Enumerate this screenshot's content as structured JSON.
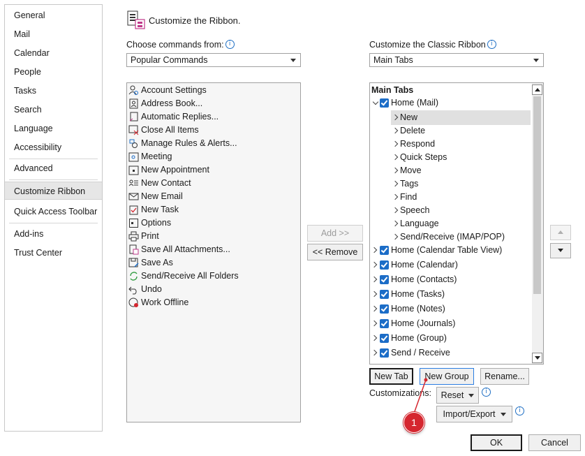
{
  "nav": {
    "items": [
      "General",
      "Mail",
      "Calendar",
      "People",
      "Tasks",
      "Search",
      "Language",
      "Accessibility",
      "Advanced",
      "Customize Ribbon",
      "Quick Access Toolbar",
      "Add-ins",
      "Trust Center"
    ],
    "selected": "Customize Ribbon"
  },
  "header": {
    "title": "Customize the Ribbon."
  },
  "left_panel": {
    "label": "Choose commands from:",
    "combo_value": "Popular Commands",
    "commands": [
      {
        "label": "Account Settings",
        "icon": "person-gear-icon"
      },
      {
        "label": "Address Book...",
        "icon": "address-book-icon"
      },
      {
        "label": "Automatic Replies...",
        "icon": "auto-reply-icon"
      },
      {
        "label": "Close All Items",
        "icon": "close-items-icon"
      },
      {
        "label": "Manage Rules & Alerts...",
        "icon": "rules-icon"
      },
      {
        "label": "Meeting",
        "icon": "meeting-icon"
      },
      {
        "label": "New Appointment",
        "icon": "appointment-icon"
      },
      {
        "label": "New Contact",
        "icon": "contact-icon"
      },
      {
        "label": "New Email",
        "icon": "email-icon"
      },
      {
        "label": "New Task",
        "icon": "task-icon"
      },
      {
        "label": "Options",
        "icon": "options-icon"
      },
      {
        "label": "Print",
        "icon": "print-icon"
      },
      {
        "label": "Save All Attachments...",
        "icon": "attachments-icon"
      },
      {
        "label": "Save As",
        "icon": "save-as-icon"
      },
      {
        "label": "Send/Receive All Folders",
        "icon": "send-receive-icon"
      },
      {
        "label": "Undo",
        "icon": "undo-icon"
      },
      {
        "label": "Work Offline",
        "icon": "work-offline-icon"
      }
    ]
  },
  "middle": {
    "add_label": "Add >>",
    "remove_label": "<< Remove"
  },
  "right_panel": {
    "label": "Customize the Classic Ribbon",
    "combo_value": "Main Tabs",
    "tree_header": "Main Tabs",
    "home_mail": "Home (Mail)",
    "home_mail_children": [
      "New",
      "Delete",
      "Respond",
      "Quick Steps",
      "Move",
      "Tags",
      "Find",
      "Speech",
      "Language",
      "Send/Receive (IMAP/POP)"
    ],
    "selected_child": "New",
    "tabs": [
      "Home (Calendar Table View)",
      "Home (Calendar)",
      "Home (Contacts)",
      "Home (Tasks)",
      "Home (Notes)",
      "Home (Journals)",
      "Home (Group)",
      "Send / Receive"
    ]
  },
  "buttons": {
    "new_tab": "New Tab",
    "new_group": "New Group",
    "rename": "Rename...",
    "customizations_label": "Customizations:",
    "reset": "Reset",
    "import_export": "Import/Export",
    "ok": "OK",
    "cancel": "Cancel"
  },
  "callout": {
    "number": "1",
    "color": "#d5262f"
  },
  "colors": {
    "checkbox": "#1c6dc7",
    "selection": "#e0e0e0"
  }
}
